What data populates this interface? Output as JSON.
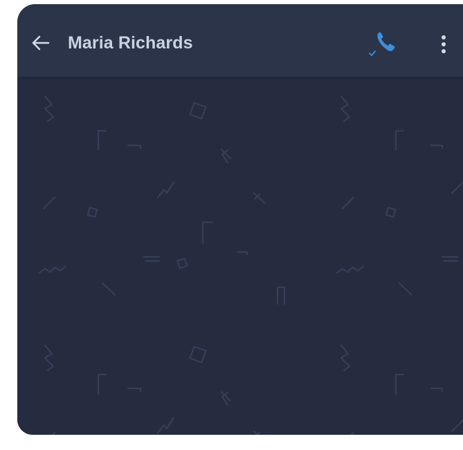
{
  "header": {
    "contact_name": "Maria Richards",
    "back_icon": "arrow-left-icon",
    "call_icon": "phone-icon",
    "menu_icon": "more-vertical-icon"
  },
  "colors": {
    "header_bg": "#2c3449",
    "chat_bg": "#252c40",
    "accent": "#3d8fe0",
    "title_text": "#c9d1e2",
    "pattern": "#363f58"
  }
}
